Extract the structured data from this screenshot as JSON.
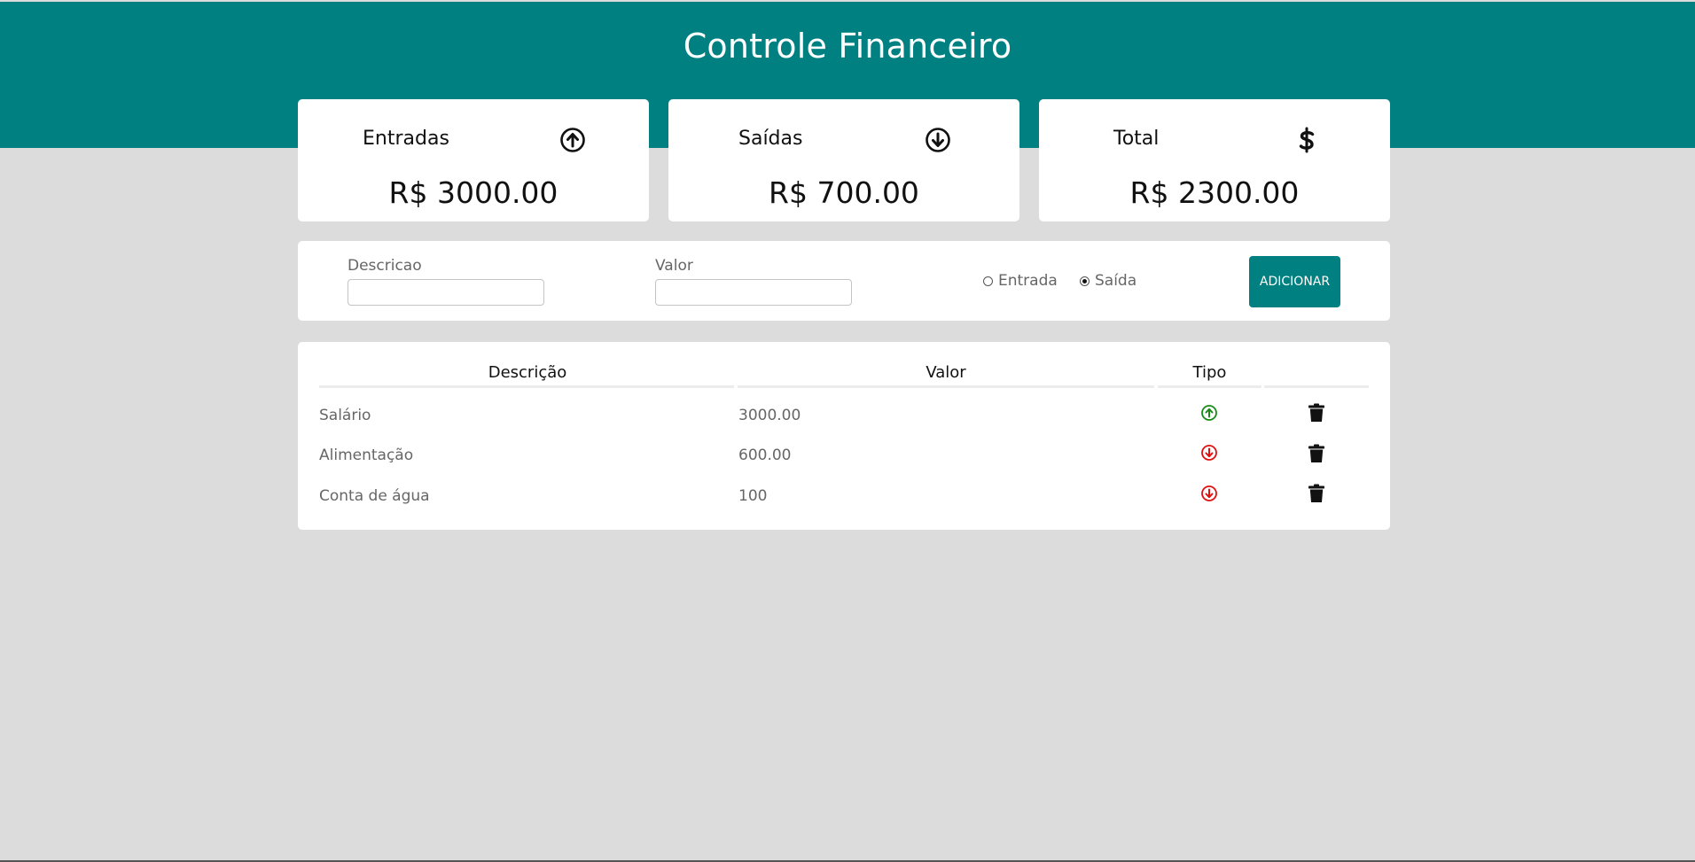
{
  "header": {
    "title": "Controle Financeiro"
  },
  "summary": {
    "income": {
      "label": "Entradas",
      "value": "R$ 3000.00",
      "icon": "arrow-circle-up-icon"
    },
    "expense": {
      "label": "Saídas",
      "value": "R$ 700.00",
      "icon": "arrow-circle-down-icon"
    },
    "total": {
      "label": "Total",
      "value": "R$ 2300.00",
      "icon": "dollar-icon"
    }
  },
  "form": {
    "description_label": "Descricao",
    "description_value": "",
    "value_label": "Valor",
    "value_value": "",
    "type_options": [
      "Entrada",
      "Saída"
    ],
    "type_selected": "Saída",
    "add_button_label": "ADICIONAR"
  },
  "table": {
    "columns": [
      "Descrição",
      "Valor",
      "Tipo",
      ""
    ],
    "rows": [
      {
        "description": "Salário",
        "value": "3000.00",
        "type": "Entrada"
      },
      {
        "description": "Alimentação",
        "value": "600.00",
        "type": "Saída"
      },
      {
        "description": "Conta de água",
        "value": "100",
        "type": "Saída"
      }
    ]
  },
  "colors": {
    "primary": "#008080",
    "background": "#dcdcdc",
    "income": "#1a8a1a",
    "expense": "#e01010"
  }
}
